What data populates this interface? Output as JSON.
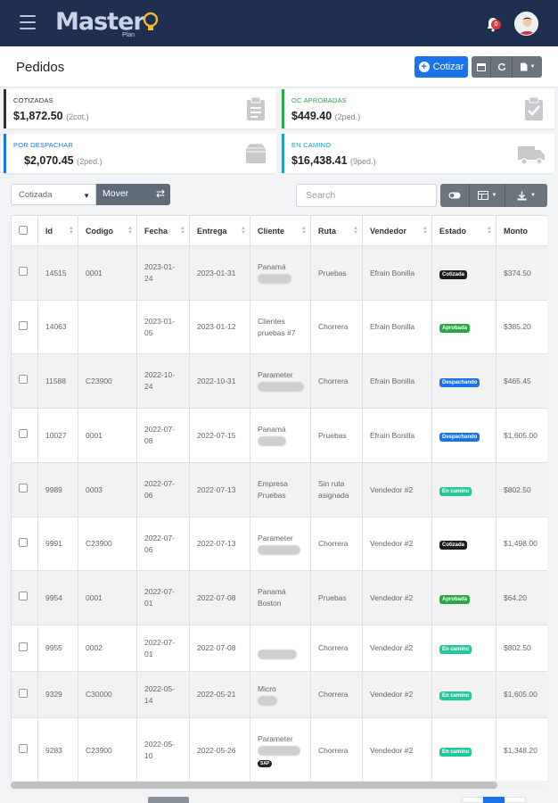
{
  "app": {
    "logo_text": "Master",
    "logo_sub": "Plan",
    "notification_count": "0"
  },
  "header": {
    "title": "Pedidos",
    "cotizar_label": "Cotizar"
  },
  "cards": [
    {
      "label": "COTIZADAS",
      "value": "$1,872.50",
      "sub": "(2cot.)",
      "color": "#333333",
      "icon": "clipboard-icon"
    },
    {
      "label": "OC APROBADAS",
      "value": "$449.40",
      "sub": "(2ped.)",
      "color": "#28a745",
      "icon": "clipboard-check-icon"
    },
    {
      "label": "POR DESPACHAR",
      "value": "$2,070.45",
      "sub": "(2ped.)",
      "color": "#1a73e8",
      "icon": "box-icon"
    },
    {
      "label": "EN CAMINO",
      "value": "$16,438.41",
      "sub": "(9ped.)",
      "color": "#17a2b8",
      "icon": "truck-icon"
    }
  ],
  "toolbar": {
    "estado_selected": "Cotizada",
    "mover_label": "Mover",
    "search_placeholder": "Search"
  },
  "table": {
    "columns": [
      "Id",
      "Codigo",
      "Fecha",
      "Entrega",
      "Cliente",
      "Ruta",
      "Vendedor",
      "Estado",
      "Monto"
    ],
    "rows": [
      {
        "id": "14515",
        "codigo": "0001",
        "fecha": "2023-01-24",
        "entrega": "2023-01-31",
        "cliente": "Panamá",
        "cliente_hidden": true,
        "ruta": "Pruebas",
        "vendedor": "Efrain Bonilla",
        "estado": "Cotizada",
        "monto": "$374.50"
      },
      {
        "id": "14063",
        "codigo": "",
        "fecha": "2023-01-05",
        "entrega": "2023-01-12",
        "cliente": "Clientes pruebas #7",
        "cliente_hidden": false,
        "ruta": "Chorrera",
        "vendedor": "Efrain Bonilla",
        "estado": "Aprobada",
        "monto": "$385.20"
      },
      {
        "id": "11588",
        "codigo": "C23900",
        "fecha": "2022-10-24",
        "entrega": "2022-10-31",
        "cliente": "Parameter",
        "cliente_hidden": true,
        "ruta": "Chorrera",
        "vendedor": "Efrain Bonilla",
        "estado": "Despachando",
        "monto": "$465.45"
      },
      {
        "id": "10027",
        "codigo": "0001",
        "fecha": "2022-07-08",
        "entrega": "2022-07-15",
        "cliente": "Panamá",
        "cliente_hidden": true,
        "ruta": "Pruebas",
        "vendedor": "Efrain Bonilla",
        "estado": "Despachando",
        "monto": "$1,605.00"
      },
      {
        "id": "9989",
        "codigo": "0003",
        "fecha": "2022-07-06",
        "entrega": "2022-07-13",
        "cliente": "Empresa Pruebas",
        "cliente_hidden": false,
        "ruta": "Sin ruta asignada",
        "vendedor": "Vendedor #2",
        "estado": "En camino",
        "monto": "$802.50"
      },
      {
        "id": "9991",
        "codigo": "C23900",
        "fecha": "2022-07-06",
        "entrega": "2022-07-13",
        "cliente": "Parameter",
        "cliente_hidden": true,
        "ruta": "Chorrera",
        "vendedor": "Vendedor #2",
        "estado": "Cotizada",
        "monto": "$1,498.00"
      },
      {
        "id": "9954",
        "codigo": "0001",
        "fecha": "2022-07-01",
        "entrega": "2022-07-08",
        "cliente": "Panamá Boston",
        "cliente_hidden": false,
        "ruta": "Pruebas",
        "vendedor": "Vendedor #2",
        "estado": "Aprobada",
        "monto": "$64.20"
      },
      {
        "id": "9955",
        "codigo": "0002",
        "fecha": "2022-07-01",
        "entrega": "2022-07-08",
        "cliente": "",
        "cliente_hidden": true,
        "ruta": "Chorrera",
        "vendedor": "Vendedor #2",
        "estado": "En camino",
        "monto": "$802.50"
      },
      {
        "id": "9329",
        "codigo": "C30000",
        "fecha": "2022-05-14",
        "entrega": "2022-05-21",
        "cliente": "Micro",
        "cliente_hidden": true,
        "ruta": "Chorrera",
        "vendedor": "Vendedor #2",
        "estado": "En camino",
        "monto": "$1,605.00"
      },
      {
        "id": "9283",
        "codigo": "C23900",
        "fecha": "2022-05-10",
        "entrega": "2022-05-26",
        "cliente": "Parameter",
        "cliente_hidden": true,
        "cliente_tag": "SAP",
        "ruta": "Chorrera",
        "vendedor": "Vendedor #2",
        "estado": "En camino",
        "monto": "$1,348.20"
      }
    ]
  },
  "estado_colors": {
    "Cotizada": "#1c1c1c",
    "Aprobada": "#28a745",
    "Despachando": "#1a73e8",
    "En camino": "#20c997"
  },
  "colors": {
    "navbar": "#1f2f4f",
    "primary": "#1a73e8",
    "secondary": "#6c757d"
  }
}
